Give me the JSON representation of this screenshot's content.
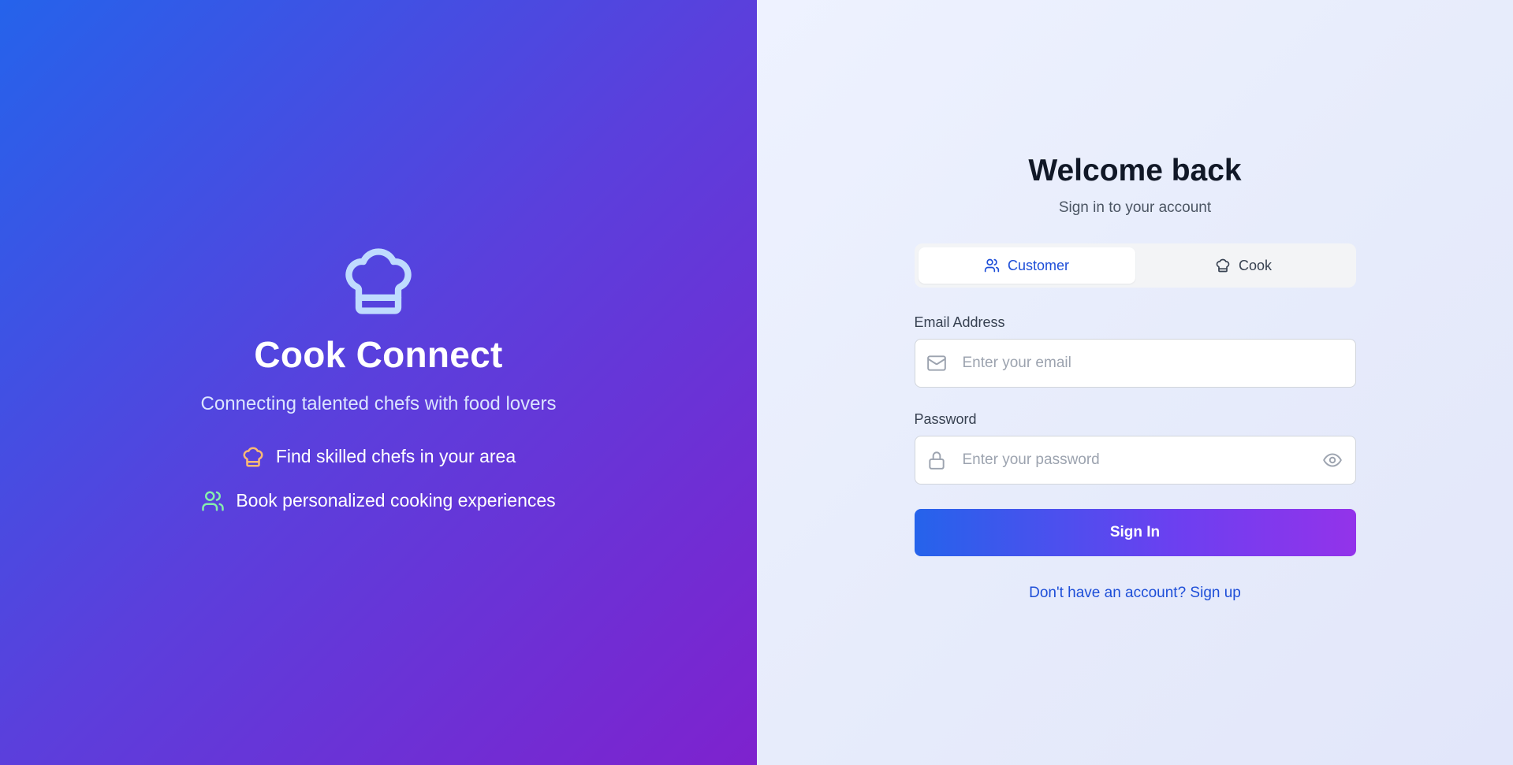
{
  "brand": {
    "title": "Cook Connect",
    "tagline": "Connecting talented chefs with food lovers",
    "icon": "chef-hat-icon",
    "features": [
      {
        "icon": "chef-hat-icon",
        "text": "Find skilled chefs in your area",
        "color": "#fdba74"
      },
      {
        "icon": "users-icon",
        "text": "Book personalized cooking experiences",
        "color": "#86efac"
      }
    ]
  },
  "form": {
    "title": "Welcome back",
    "subtitle": "Sign in to your account",
    "tabs": [
      {
        "label": "Customer",
        "icon": "users-icon",
        "active": true
      },
      {
        "label": "Cook",
        "icon": "chef-hat-icon",
        "active": false
      }
    ],
    "email": {
      "label": "Email Address",
      "placeholder": "Enter your email",
      "value": "",
      "icon": "mail-icon"
    },
    "password": {
      "label": "Password",
      "placeholder": "Enter your password",
      "value": "",
      "icon": "lock-icon",
      "toggle_icon": "eye-icon"
    },
    "submit_label": "Sign In",
    "signup_link": "Don't have an account? Sign up"
  },
  "colors": {
    "accent": "#1d4ed8",
    "gradient_start": "#2563eb",
    "gradient_end": "#9333ea"
  }
}
